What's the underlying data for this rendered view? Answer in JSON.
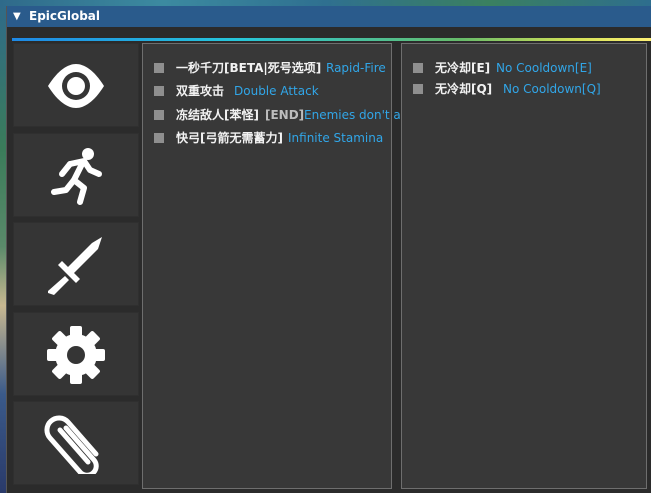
{
  "window": {
    "title": "EpicGlobal"
  },
  "sidebar": [
    {
      "icon": "eye-icon"
    },
    {
      "icon": "running-man-icon"
    },
    {
      "icon": "sword-icon"
    },
    {
      "icon": "gear-icon"
    },
    {
      "icon": "paperclip-icon"
    }
  ],
  "left_panel": {
    "options": [
      {
        "label_cn": "一秒千刀[BETA|死号选项]",
        "label_en": "Rapid-Fire"
      },
      {
        "label_cn": "双重攻击",
        "label_en": "Double Attack"
      },
      {
        "label_cn": "冻结敌人[苯怪]",
        "label_mid": "[END]",
        "label_en": "Enemies don't attack [hotkey:END]"
      },
      {
        "label_cn": "快弓[弓箭无需蓄力]",
        "label_en": "Infinite Stamina"
      }
    ]
  },
  "right_panel": {
    "options": [
      {
        "label_cn": "无冷却[E]",
        "label_en": "No Cooldown[E]"
      },
      {
        "label_cn": "无冷却[Q]",
        "label_en": "No Cooldown[Q]"
      }
    ]
  },
  "colors": {
    "accent": "#31a6e8",
    "title_bar": "#2a5b8c",
    "panel": "#383838",
    "checkbox": "#8f8f8f"
  }
}
